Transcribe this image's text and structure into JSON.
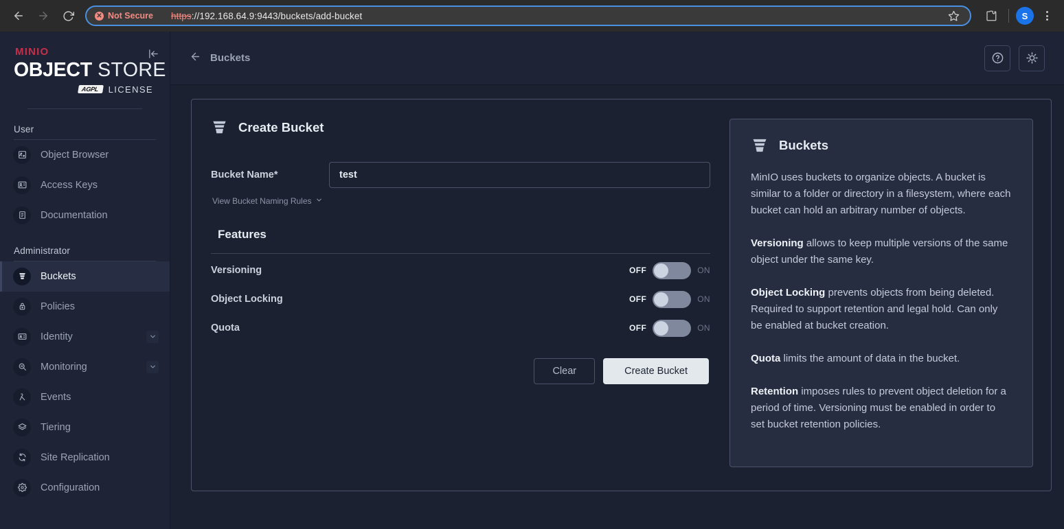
{
  "browser": {
    "back_icon": "back-arrow-icon",
    "forward_icon": "forward-arrow-icon",
    "reload_icon": "reload-icon",
    "security_label": "Not Secure",
    "url_scheme": "https",
    "url_rest": "://192.168.64.9:9443/buckets/add-bucket",
    "full_url": "https://192.168.64.9:9443/buckets/add-bucket",
    "bookmark_icon": "star-icon",
    "extensions_icon": "puzzle-piece-icon",
    "profile_initial": "S",
    "menu_icon": "kebab-menu-icon"
  },
  "sidebar": {
    "logo": {
      "brand": "MINIO",
      "product_bold": "OBJECT",
      "product_light": " STORE",
      "license_badge": "AGPL",
      "license_text": "LICENSE"
    },
    "collapse_icon": "collapse-sidebar-icon",
    "sections": [
      {
        "title": "User",
        "items": [
          {
            "label": "Object Browser",
            "icon": "object-browser-icon",
            "active": false,
            "expandable": false
          },
          {
            "label": "Access Keys",
            "icon": "access-keys-icon",
            "active": false,
            "expandable": false
          },
          {
            "label": "Documentation",
            "icon": "documentation-icon",
            "active": false,
            "expandable": false
          }
        ]
      },
      {
        "title": "Administrator",
        "items": [
          {
            "label": "Buckets",
            "icon": "bucket-icon",
            "active": true,
            "expandable": false
          },
          {
            "label": "Policies",
            "icon": "lock-icon",
            "active": false,
            "expandable": false
          },
          {
            "label": "Identity",
            "icon": "identity-card-icon",
            "active": false,
            "expandable": true
          },
          {
            "label": "Monitoring",
            "icon": "monitoring-icon",
            "active": false,
            "expandable": true
          },
          {
            "label": "Events",
            "icon": "lambda-icon",
            "active": false,
            "expandable": false
          },
          {
            "label": "Tiering",
            "icon": "layers-icon",
            "active": false,
            "expandable": false
          },
          {
            "label": "Site Replication",
            "icon": "sync-icon",
            "active": false,
            "expandable": false
          },
          {
            "label": "Configuration",
            "icon": "gear-icon",
            "active": false,
            "expandable": false
          }
        ]
      }
    ]
  },
  "topbar": {
    "back_icon": "back-arrow-icon",
    "breadcrumb": "Buckets",
    "help_icon": "help-circle-icon",
    "theme_icon": "light-mode-icon"
  },
  "form": {
    "icon": "bucket-icon",
    "title": "Create Bucket",
    "bucket_name_label": "Bucket Name*",
    "bucket_name_value": "test",
    "bucket_name_placeholder": "",
    "naming_rules_link": "View Bucket Naming Rules",
    "naming_rules_chevron": "chevron-down-icon",
    "features_title": "Features",
    "features": [
      {
        "name": "Versioning",
        "off_label": "OFF",
        "on_label": "ON",
        "state": "off"
      },
      {
        "name": "Object Locking",
        "off_label": "OFF",
        "on_label": "ON",
        "state": "off"
      },
      {
        "name": "Quota",
        "off_label": "OFF",
        "on_label": "ON",
        "state": "off"
      }
    ],
    "clear_button": "Clear",
    "create_button": "Create Bucket"
  },
  "help": {
    "icon": "bucket-icon",
    "title": "Buckets",
    "paragraphs": [
      {
        "bold": "",
        "text": "MinIO uses buckets to organize objects. A bucket is similar to a folder or directory in a filesystem, where each bucket can hold an arbitrary number of objects."
      },
      {
        "bold": "Versioning",
        "text": " allows to keep multiple versions of the same object under the same key."
      },
      {
        "bold": "Object Locking",
        "text": " prevents objects from being deleted. Required to support retention and legal hold. Can only be enabled at bucket creation."
      },
      {
        "bold": "Quota",
        "text": " limits the amount of data in the bucket."
      },
      {
        "bold": "Retention",
        "text": " imposes rules to prevent object deletion for a period of time. Versioning must be enabled in order to set bucket retention policies."
      }
    ]
  },
  "colors": {
    "page_bg": "#1b2130",
    "sidebar_bg": "#1e2436",
    "help_panel_bg": "#262d40",
    "brand_red": "#c72e49",
    "accent_blue": "#4a90e2",
    "not_secure_red": "#f28b82",
    "primary_button_bg": "#e3e8ed"
  }
}
